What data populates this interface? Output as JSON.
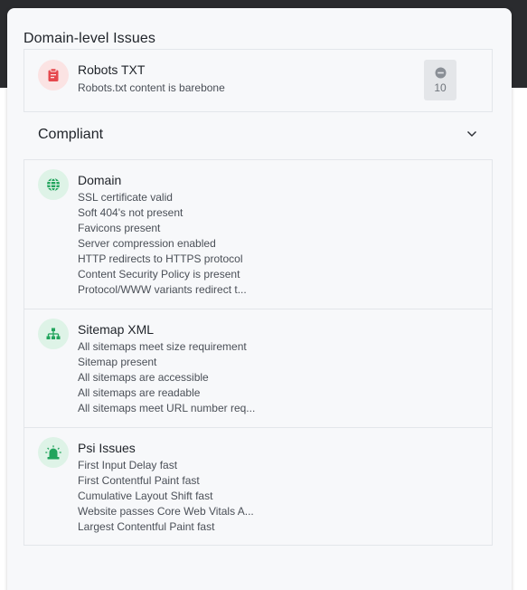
{
  "domain_issues": {
    "title": "Domain-level Issues",
    "items": [
      {
        "title": "Robots TXT",
        "description": "Robots.txt content is barebone",
        "count": "10",
        "icon": "clipboard-icon",
        "icon_color": "#e5484d"
      }
    ]
  },
  "compliant": {
    "title": "Compliant",
    "toggle_icon": "chevron-down-icon",
    "items": [
      {
        "title": "Domain",
        "icon": "globe-icon",
        "lines": [
          "SSL certificate valid",
          "Soft 404's not present",
          "Favicons present",
          "Server compression enabled",
          "HTTP redirects to HTTPS protocol",
          "Content Security Policy is present",
          "Protocol/WWW variants redirect t..."
        ]
      },
      {
        "title": "Sitemap XML",
        "icon": "sitemap-icon",
        "lines": [
          "All sitemaps meet size requirement",
          "Sitemap present",
          "All sitemaps are accessible",
          "All sitemaps are readable",
          "All sitemaps meet URL number req..."
        ]
      },
      {
        "title": "Psi Issues",
        "icon": "siren-icon",
        "lines": [
          "First Input Delay fast",
          "First Contentful Paint fast",
          "Cumulative Layout Shift fast",
          "Website passes Core Web Vitals A...",
          "Largest Contentful Paint fast"
        ]
      }
    ]
  },
  "colors": {
    "success": "#22a45d",
    "danger": "#e5484d",
    "panel_bg": "#f7f8fa",
    "header_bg": "#2a2b2e"
  }
}
